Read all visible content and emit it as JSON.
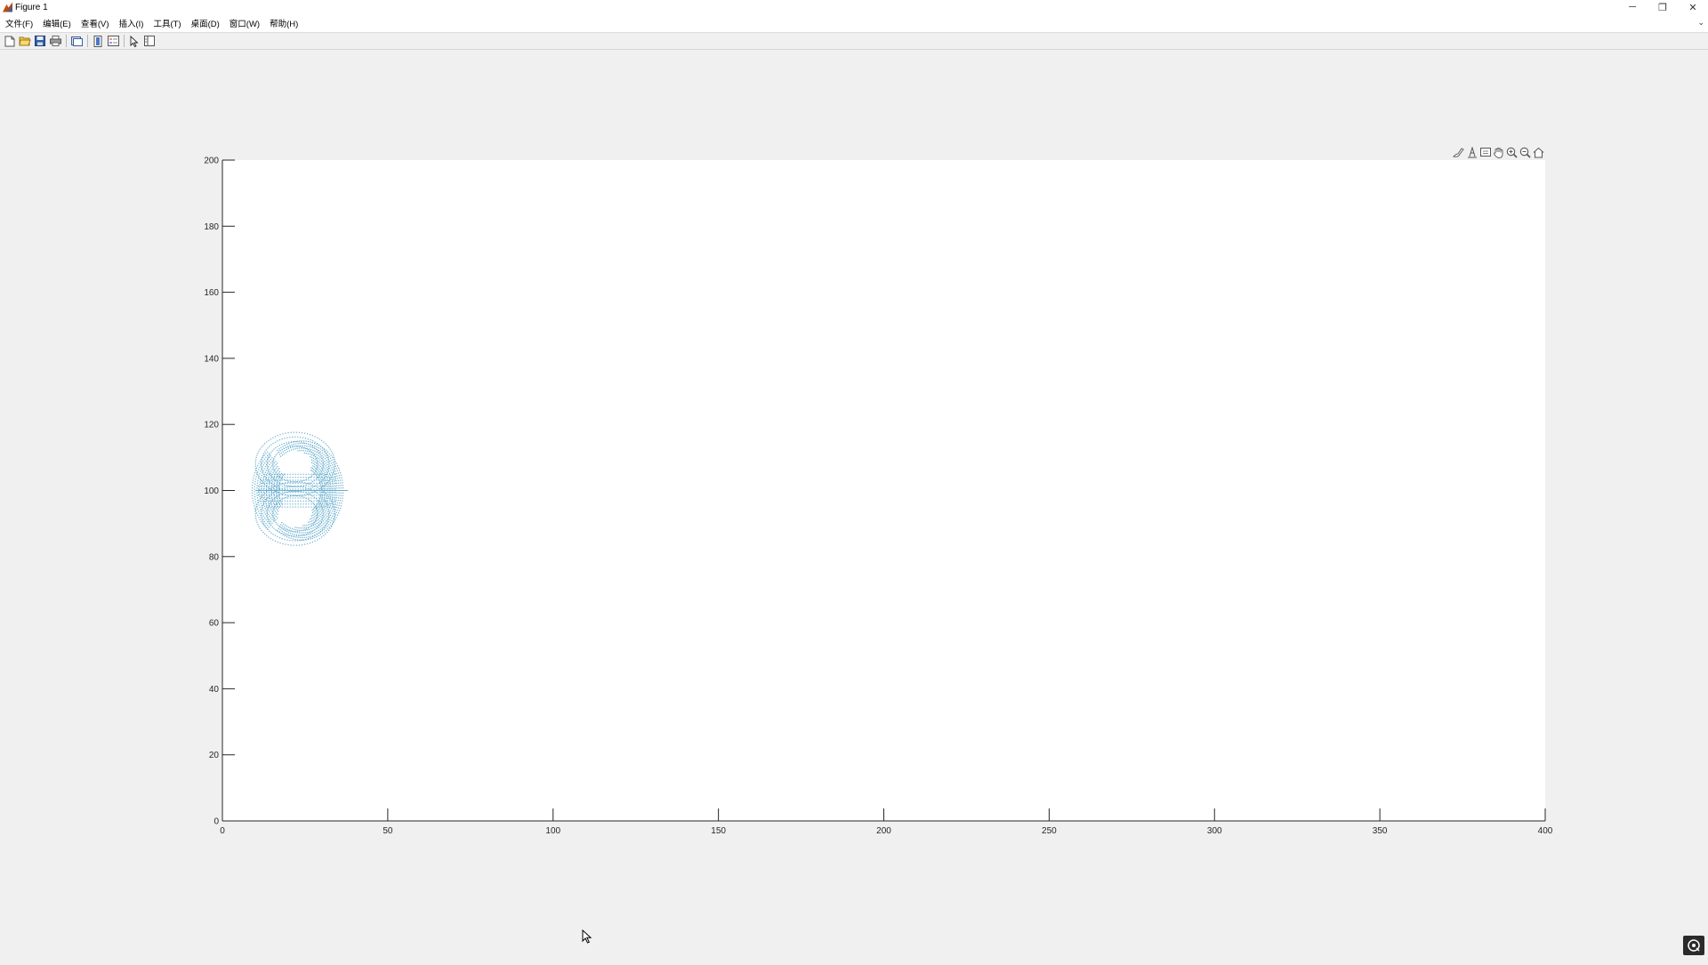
{
  "window": {
    "title": "Figure 1",
    "controls": {
      "minimize": "─",
      "restore": "❐",
      "close": "✕"
    }
  },
  "menu": {
    "items": [
      {
        "label": "文件(F)"
      },
      {
        "label": "编辑(E)"
      },
      {
        "label": "查看(V)"
      },
      {
        "label": "插入(I)"
      },
      {
        "label": "工具(T)"
      },
      {
        "label": "桌面(D)"
      },
      {
        "label": "窗口(W)"
      },
      {
        "label": "帮助(H)"
      }
    ]
  },
  "toolbar": {
    "icons": [
      "new-figure-icon",
      "open-file-icon",
      "save-icon",
      "print-icon",
      "link-plot-icon",
      "colorbar-icon",
      "legend-icon",
      "edit-plot-icon",
      "property-inspector-icon"
    ]
  },
  "axes_toolbar": {
    "icons": [
      "brush-icon",
      "data-tip-icon",
      "export-icon",
      "pan-icon",
      "zoom-in-icon",
      "zoom-out-icon",
      "home-icon"
    ]
  },
  "colors": {
    "plot": "#6aaecd",
    "axis": "#262626"
  },
  "chart_data": {
    "type": "scatter",
    "title": "",
    "xlabel": "",
    "ylabel": "",
    "xlim": [
      0,
      400
    ],
    "ylim": [
      0,
      200
    ],
    "xticks": [
      0,
      50,
      100,
      150,
      200,
      250,
      300,
      350,
      400
    ],
    "yticks": [
      0,
      20,
      40,
      60,
      80,
      100,
      120,
      140,
      160,
      180,
      200
    ],
    "grid": false,
    "legend": "none",
    "series": [
      {
        "description_shape": "streamline point cloud around two vortices",
        "center": [
          24,
          100
        ],
        "outer_radius_x": 12.5,
        "outer_radius_y": 15,
        "inner_vortices": [
          {
            "center": [
              22,
              108
            ],
            "rx": 5,
            "ry": 4
          },
          {
            "center": [
              22,
              93
            ],
            "rx": 5,
            "ry": 4
          }
        ],
        "centerline": {
          "x0": 10,
          "x1": 38,
          "y": 100
        }
      }
    ]
  }
}
